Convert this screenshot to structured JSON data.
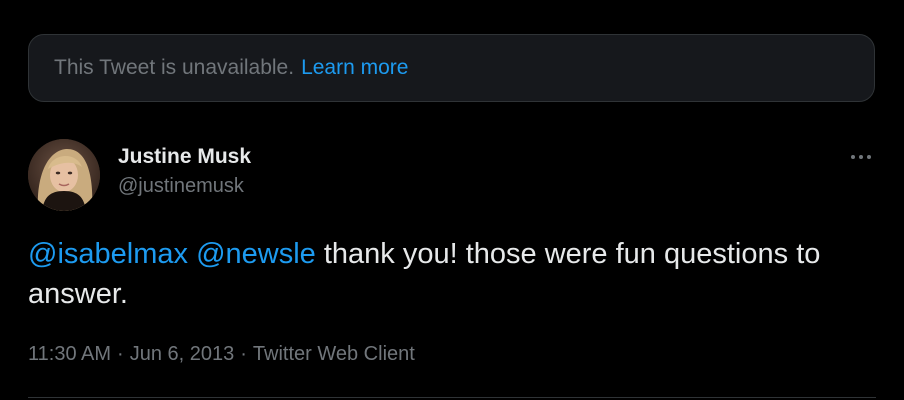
{
  "unavailable": {
    "message": "This Tweet is unavailable.",
    "learn_more": "Learn more"
  },
  "author": {
    "name": "Justine Musk",
    "handle": "@justinemusk"
  },
  "tweet": {
    "mention_1": "@isabelmax",
    "mention_2": "@newsle",
    "text": " thank you! those were fun questions to answer."
  },
  "meta": {
    "time": "11:30 AM",
    "separator": "·",
    "date": "Jun 6, 2013",
    "client": "Twitter Web Client"
  },
  "icons": {
    "more": "more-horizontal-icon",
    "avatar": "user-avatar"
  },
  "colors": {
    "background": "#000000",
    "accent": "#1d9bf0",
    "text": "#e7e9ea",
    "muted": "#71767b",
    "card": "#16181c",
    "border": "#2f3336"
  }
}
